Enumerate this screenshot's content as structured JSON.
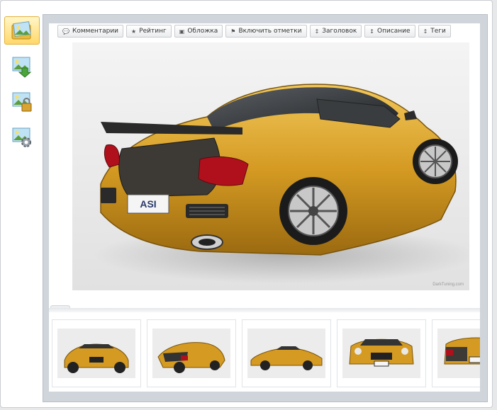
{
  "toolbar": {
    "buttons": [
      {
        "label": "Комментарии",
        "icon": "comment-icon"
      },
      {
        "label": "Рейтинг",
        "icon": "star-icon"
      },
      {
        "label": "Обложка",
        "icon": "image-icon"
      },
      {
        "label": "Включить отметки",
        "icon": "tag-icon"
      },
      {
        "label": "Заголовок",
        "icon": "sort-icon"
      },
      {
        "label": "Описание",
        "icon": "sort-icon"
      },
      {
        "label": "Теги",
        "icon": "sort-icon"
      }
    ]
  },
  "sidebar": {
    "items": [
      {
        "icon": "photo-folder-icon",
        "active": true
      },
      {
        "icon": "photo-download-icon",
        "active": false
      },
      {
        "icon": "photo-lock-icon",
        "active": false
      },
      {
        "icon": "photo-settings-icon",
        "active": false
      }
    ]
  },
  "photo": {
    "plate_text": "ASI",
    "watermark": "DarkTuning.com"
  },
  "colors": {
    "accent": "#ffd86a",
    "car_gold": "#d8a028",
    "frame": "#cfd5da"
  }
}
